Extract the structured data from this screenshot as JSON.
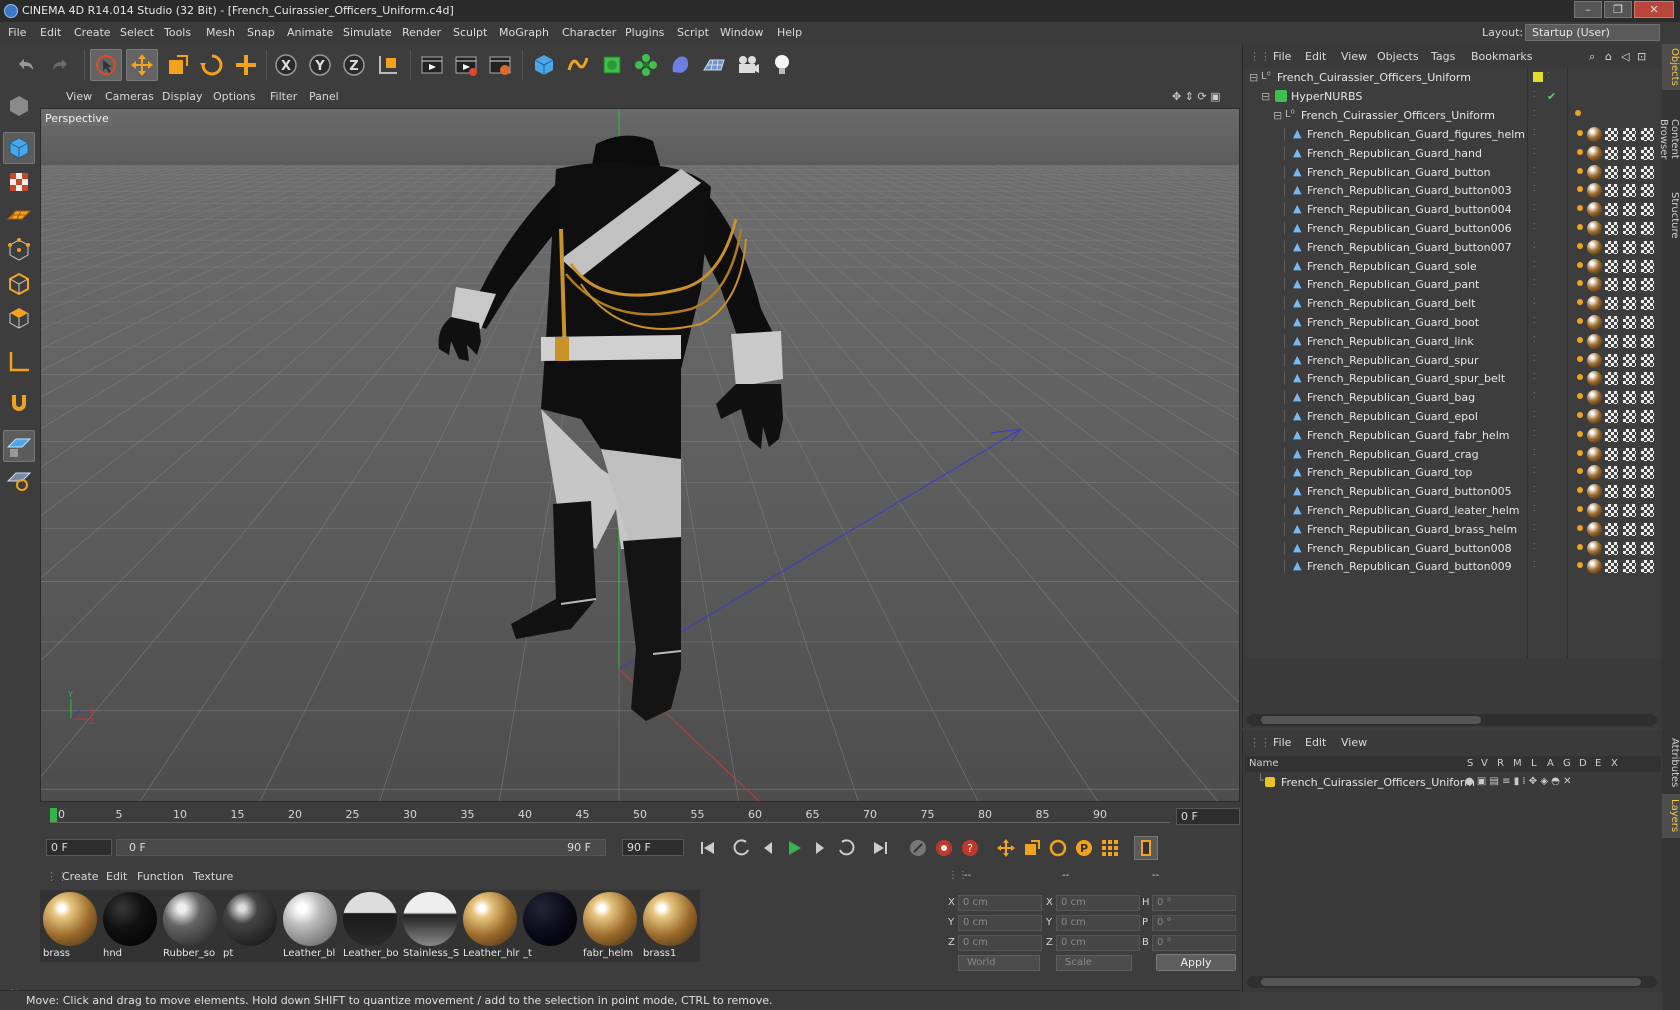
{
  "window": {
    "title": "CINEMA 4D R14.014 Studio (32 Bit) - [French_Cuirassier_Officers_Uniform.c4d]",
    "controls": [
      "–",
      "❐",
      "✕"
    ]
  },
  "menubar": {
    "items": [
      "File",
      "Edit",
      "Create",
      "Select",
      "Tools",
      "Mesh",
      "Snap",
      "Animate",
      "Simulate",
      "Render",
      "Sculpt",
      "MoGraph",
      "Character",
      "Plugins",
      "Script",
      "Window",
      "Help"
    ],
    "layout_label": "Layout:",
    "layout_value": "Startup (User)"
  },
  "toolbar": {
    "icons": [
      "undo-icon",
      "redo-icon",
      "live-selection-icon",
      "move-icon",
      "scale-icon",
      "rotate-icon",
      "add-icon",
      "x-axis-icon",
      "y-axis-icon",
      "z-axis-icon",
      "coordinate-system-icon",
      "render-view-icon",
      "render-picture-viewer-icon",
      "edit-render-settings-icon",
      "cube-icon",
      "spline-pen-icon",
      "subdivision-icon",
      "array-icon",
      "deformer-icon",
      "floor-icon",
      "camera-icon",
      "light-icon"
    ]
  },
  "viewport": {
    "menu": [
      "View",
      "Cameras",
      "Display",
      "Options",
      "Filter",
      "Panel"
    ],
    "label": "Perspective",
    "axis": {
      "x": "X",
      "y": "Y",
      "z": "Z"
    }
  },
  "timeline": {
    "ticks": [
      "0",
      "5",
      "10",
      "15",
      "20",
      "25",
      "30",
      "35",
      "40",
      "45",
      "50",
      "55",
      "60",
      "65",
      "70",
      "75",
      "80",
      "85",
      "90"
    ],
    "current_frame": "0 F",
    "start_frame": "0 F",
    "range_start": "0 F",
    "range_end": "90 F",
    "end_frame": "90 F"
  },
  "materials": {
    "menu": [
      "Create",
      "Edit",
      "Function",
      "Texture"
    ],
    "items": [
      {
        "label": "brass",
        "style": "brass"
      },
      {
        "label": "hnd",
        "style": "black"
      },
      {
        "label": "Rubber_so",
        "style": "rubber"
      },
      {
        "label": "pt",
        "style": "dark"
      },
      {
        "label": "Leather_bl",
        "style": "grey"
      },
      {
        "label": "Leather_bo",
        "style": "darkchrome"
      },
      {
        "label": "Stainless_S",
        "style": "chrome"
      },
      {
        "label": "Leather_hlr",
        "style": "brass"
      },
      {
        "label": "_t",
        "style": "navy"
      },
      {
        "label": "fabr_helm",
        "style": "brass"
      },
      {
        "label": "brass1",
        "style": "brass"
      }
    ]
  },
  "coordinates": {
    "headers": [
      "--",
      "--",
      "--"
    ],
    "rows": [
      {
        "a": "X",
        "av": "0 cm",
        "b": "X",
        "bv": "0 cm",
        "c": "H",
        "cv": "0 °"
      },
      {
        "a": "Y",
        "av": "0 cm",
        "b": "Y",
        "bv": "0 cm",
        "c": "P",
        "cv": "0 °"
      },
      {
        "a": "Z",
        "av": "0 cm",
        "b": "Z",
        "bv": "0 cm",
        "c": "B",
        "cv": "0 °"
      }
    ],
    "mode1": "World",
    "mode2": "Scale",
    "apply": "Apply"
  },
  "status": {
    "text": "Move: Click and drag to move elements. Hold down SHIFT to quantize movement / add to the selection in point mode, CTRL to remove."
  },
  "object_manager": {
    "menu": [
      "File",
      "Edit",
      "View",
      "Objects",
      "Tags",
      "Bookmarks"
    ],
    "root": "French_Cuirassier_Officers_Uniform",
    "hypernurbs": "HyperNURBS",
    "group": "French_Cuirassier_Officers_Uniform",
    "objects": [
      "French_Republican_Guard_figures_helm",
      "French_Republican_Guard_hand",
      "French_Republican_Guard_button",
      "French_Republican_Guard_button003",
      "French_Republican_Guard_button004",
      "French_Republican_Guard_button006",
      "French_Republican_Guard_button007",
      "French_Republican_Guard_sole",
      "French_Republican_Guard_pant",
      "French_Republican_Guard_belt",
      "French_Republican_Guard_boot",
      "French_Republican_Guard_link",
      "French_Republican_Guard_spur",
      "French_Republican_Guard_spur_belt",
      "French_Republican_Guard_bag",
      "French_Republican_Guard_epol",
      "French_Republican_Guard_fabr_helm",
      "French_Republican_Guard_crag",
      "French_Republican_Guard_top",
      "French_Republican_Guard_button005",
      "French_Republican_Guard_leater_helm",
      "French_Republican_Guard_brass_helm",
      "French_Republican_Guard_button008",
      "French_Republican_Guard_button009"
    ]
  },
  "layer_manager": {
    "menu": [
      "File",
      "Edit",
      "View"
    ],
    "columns": [
      "Name",
      "S",
      "V",
      "R",
      "M",
      "L",
      "A",
      "G",
      "D",
      "E",
      "X"
    ],
    "layer": "French_Cuirassier_Officers_Uniform",
    "layer_color": "#e8c520"
  },
  "side_tabs": [
    "Objects",
    "Content Browser",
    "Structure",
    "Attributes",
    "Layers"
  ],
  "colors": {
    "accent": "#f1c94d",
    "selection_green": "#36b34a",
    "toolbar_blue": "#4aa6e8",
    "toolbar_orange": "#f2a21e"
  }
}
